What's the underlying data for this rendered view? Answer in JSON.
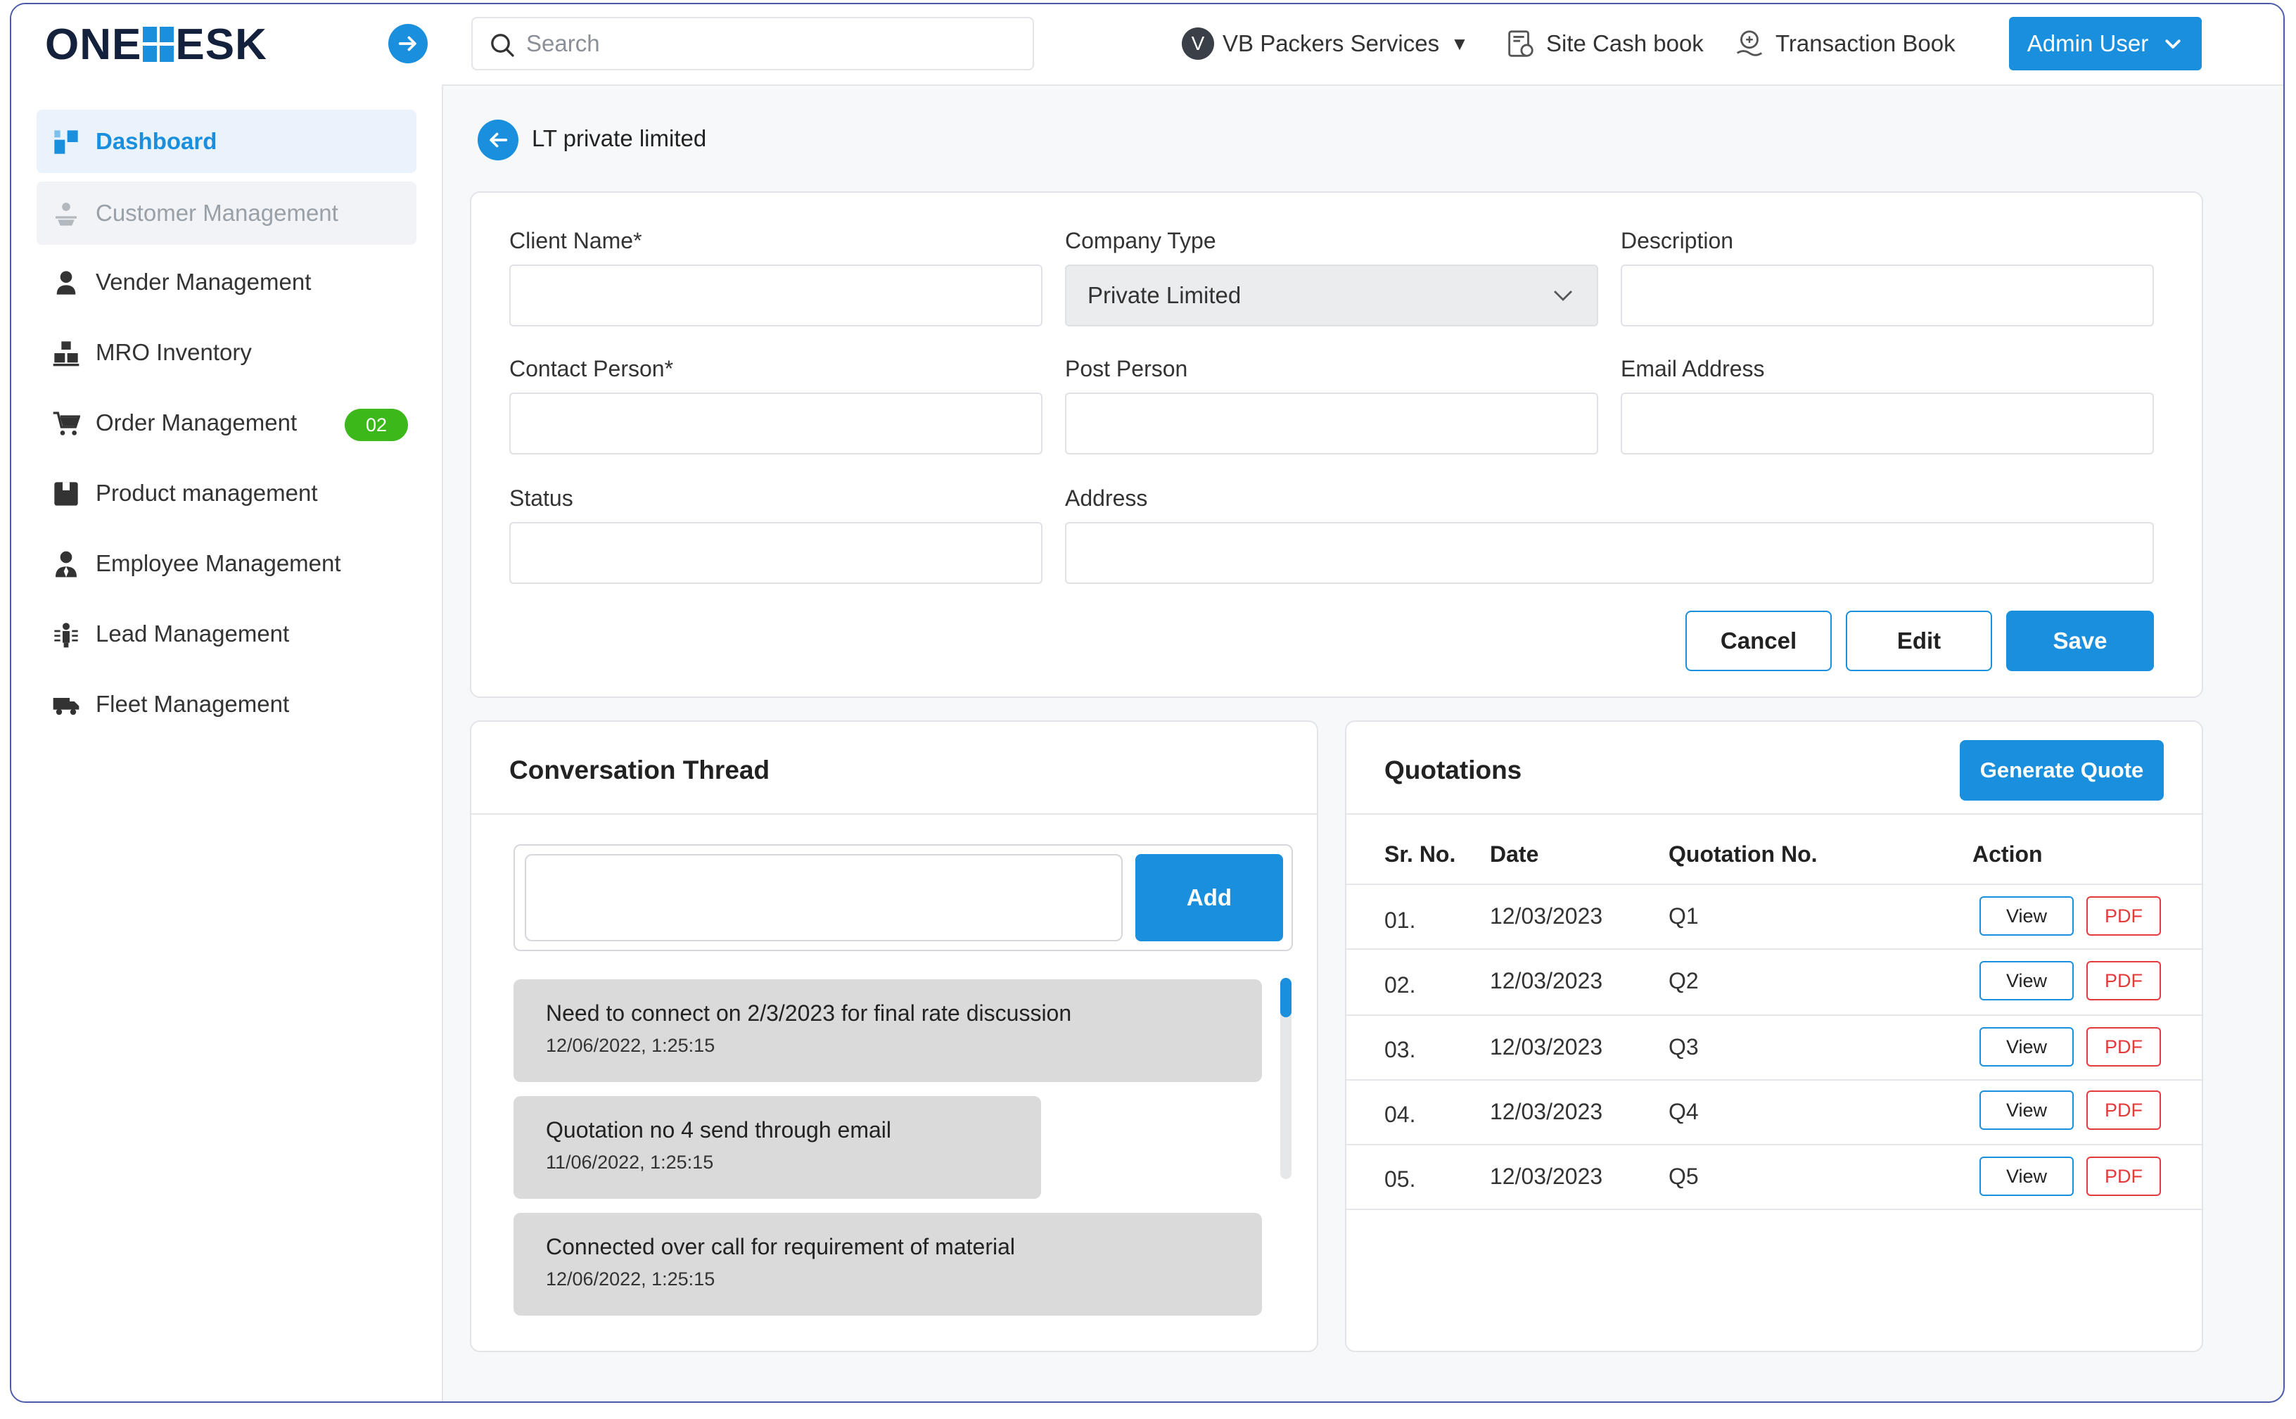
{
  "app": {
    "logo_left": "ONE",
    "logo_right": "ESK"
  },
  "header": {
    "search_placeholder": "Search",
    "company_initial": "V",
    "company_name": "VB Packers Services",
    "site_cash_book": "Site Cash book",
    "transaction_book": "Transaction Book",
    "user_menu": "Admin User"
  },
  "sidebar": {
    "items": [
      {
        "label": "Dashboard",
        "icon": "dashboard-icon"
      },
      {
        "label": "Customer Management",
        "icon": "customer-icon"
      },
      {
        "label": "Vender Management",
        "icon": "person-icon"
      },
      {
        "label": "MRO Inventory",
        "icon": "inventory-icon"
      },
      {
        "label": "Order Management",
        "icon": "cart-icon",
        "badge": "02"
      },
      {
        "label": "Product management",
        "icon": "box-icon"
      },
      {
        "label": "Employee Management",
        "icon": "employee-icon"
      },
      {
        "label": "Lead Management",
        "icon": "lead-icon"
      },
      {
        "label": "Fleet Management",
        "icon": "truck-icon"
      }
    ]
  },
  "page": {
    "title": "LT private limited"
  },
  "form": {
    "client_name_label": "Client Name*",
    "company_type_label": "Company Type",
    "company_type_value": "Private Limited",
    "description_label": "Description",
    "contact_person_label": "Contact Person*",
    "post_person_label": "Post Person",
    "email_label": "Email Address",
    "status_label": "Status",
    "address_label": "Address",
    "cancel": "Cancel",
    "edit": "Edit",
    "save": "Save"
  },
  "conversation": {
    "title": "Conversation Thread",
    "add": "Add",
    "messages": [
      {
        "text": "Need to connect on 2/3/2023 for final rate discussion",
        "date": "12/06/2022, 1:25:15"
      },
      {
        "text": "Quotation no 4 send through email",
        "date": "11/06/2022, 1:25:15"
      },
      {
        "text": "Connected over call for requirement of material",
        "date": "12/06/2022, 1:25:15"
      }
    ]
  },
  "quotations": {
    "title": "Quotations",
    "generate": "Generate Quote",
    "columns": [
      "Sr. No.",
      "Date",
      "Quotation No.",
      "Action"
    ],
    "rows": [
      {
        "sr": "01.",
        "date": "12/03/2023",
        "no": "Q1"
      },
      {
        "sr": "02.",
        "date": "12/03/2023",
        "no": "Q2"
      },
      {
        "sr": "03.",
        "date": "12/03/2023",
        "no": "Q3"
      },
      {
        "sr": "04.",
        "date": "12/03/2023",
        "no": "Q4"
      },
      {
        "sr": "05.",
        "date": "12/03/2023",
        "no": "Q5"
      }
    ],
    "view_label": "View",
    "pdf_label": "PDF"
  },
  "colors": {
    "accent": "#1a8fdd",
    "badge": "#3cb81b",
    "danger": "#e33a3a"
  }
}
